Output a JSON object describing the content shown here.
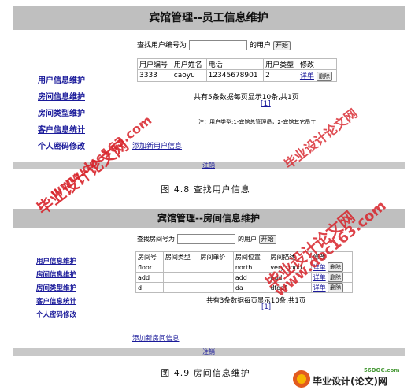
{
  "screen1": {
    "title": "宾馆管理--员工信息维护",
    "sidebar": [
      "用户信息维护",
      "房间信息维护",
      "房间类型维护",
      "客户信息统计",
      "个人密码修改"
    ],
    "search_label": "查找用户编号为",
    "search_suffix": "的用户",
    "search_button": "开始",
    "table_headers": [
      "用户编号",
      "用户姓名",
      "电话",
      "用户类型",
      "修改"
    ],
    "rows": [
      [
        "3333",
        "caoyu",
        "12345678901",
        "2",
        "详单",
        "删除"
      ]
    ],
    "page_info": "共有5条数据每页显示10条,共1页",
    "page_num": "[1]",
    "note": "注：用户类型:1-宾馆总管理员，2-宾馆其它员工",
    "add_link": "添加新用户信息",
    "logout": "注销"
  },
  "caption1": "图 4.8  查找用户信息",
  "screen2": {
    "title": "宾馆管理--房间信息维护",
    "sidebar": [
      "用户信息维护",
      "房间信息维护",
      "房间类型维护",
      "客户信息统计",
      "个人密码修改"
    ],
    "search_label": "查找房间号为",
    "search_suffix": "的用户",
    "search_button": "开始",
    "table_headers": [
      "房间号",
      "房间类型",
      "房间单价",
      "房间位置",
      "房间描述",
      "修改"
    ],
    "rows": [
      [
        "floor",
        "",
        "",
        "north",
        "very good",
        "详单",
        "删除"
      ],
      [
        "add",
        "",
        "",
        "add",
        "add",
        "详单",
        "删除"
      ],
      [
        "d",
        "",
        "",
        "da",
        "dfdaf",
        "详单",
        "删除"
      ]
    ],
    "page_info": "共有3条数据每页显示10条,共1页",
    "page_num": "[1]",
    "add_link": "添加新房间信息",
    "logout": "注销"
  },
  "caption2": "图 4.9  房间信息维护",
  "watermarks": {
    "w1": "毕业设计论文网",
    "w2": "www.doc163.com",
    "w3": "毕业设计论文网",
    "w4": "www.doc163.com",
    "w5": "毕业设计论文网",
    "logo_url": "56DOC.com",
    "logo_text": "毕业设计(论文)网"
  }
}
